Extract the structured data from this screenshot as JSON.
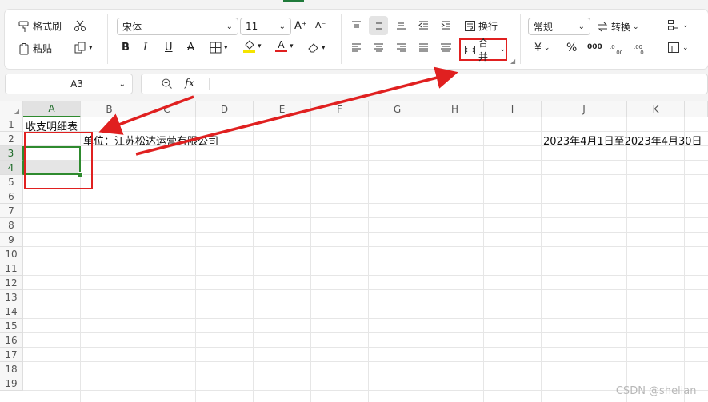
{
  "ribbon": {
    "format_painter": "格式刷",
    "paste": "粘贴",
    "font_name": "宋体",
    "font_size": "11",
    "bold": "B",
    "italic": "I",
    "underline": "U",
    "strike": "A",
    "font_color_letter": "A",
    "wrap_text": "换行",
    "merge": "合并",
    "number_format": "常规",
    "convert": "转换",
    "grow_font": "A⁺",
    "shrink_font": "A⁻",
    "currency": "¥",
    "percent": "%",
    "thousands": "000"
  },
  "formula_bar": {
    "name_box": "A3",
    "fx": "fx",
    "formula": ""
  },
  "columns": [
    "A",
    "B",
    "C",
    "D",
    "E",
    "F",
    "G",
    "H",
    "I",
    "J",
    "K"
  ],
  "rows": [
    "1",
    "2",
    "3",
    "4",
    "5",
    "6",
    "7",
    "8",
    "9",
    "10",
    "11",
    "12",
    "13",
    "14",
    "15",
    "16",
    "17",
    "18",
    "19"
  ],
  "cells": {
    "a1": "收支明细表",
    "b2": "单位：江苏松达运营有限公司",
    "j2": "2023年4月1日至2023年4月30日"
  },
  "colors": {
    "accent_green": "#1f7a3a",
    "annotation_red": "#e02020"
  },
  "watermark": "CSDN @shelian_"
}
